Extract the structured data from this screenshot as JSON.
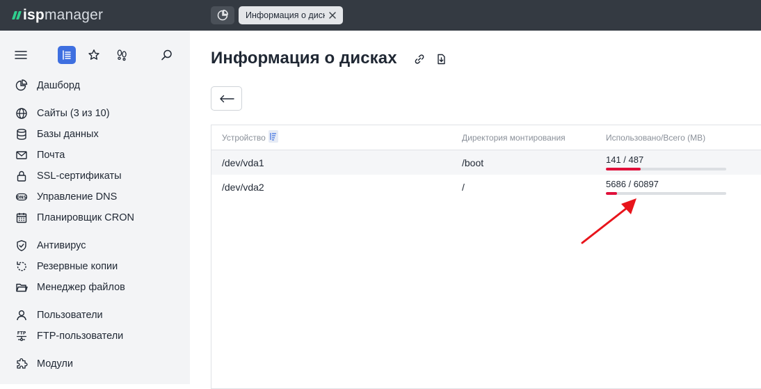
{
  "app": {
    "logo_isp": "isp",
    "logo_manager": "manager"
  },
  "tabs": {
    "active_label": "Информация о дисках"
  },
  "sidebar": {
    "items": [
      {
        "label": "Дашборд",
        "icon": "pie-chart-icon"
      },
      {
        "label": "Сайты (3 из 10)",
        "icon": "globe-icon"
      },
      {
        "label": "Базы данных",
        "icon": "database-icon"
      },
      {
        "label": "Почта",
        "icon": "mail-icon"
      },
      {
        "label": "SSL-сертификаты",
        "icon": "lock-icon"
      },
      {
        "label": "Управление DNS",
        "icon": "dns-icon"
      },
      {
        "label": "Планировщик CRON",
        "icon": "calendar-icon"
      },
      {
        "label": "Антивирус",
        "icon": "shield-icon"
      },
      {
        "label": "Резервные копии",
        "icon": "backup-icon"
      },
      {
        "label": "Менеджер файлов",
        "icon": "folder-icon"
      },
      {
        "label": "Пользователи",
        "icon": "user-icon"
      },
      {
        "label": "FTP-пользователи",
        "icon": "ftp-icon"
      },
      {
        "label": "Модули",
        "icon": "puzzle-icon"
      }
    ]
  },
  "page": {
    "title": "Информация о дисках",
    "back_symbol": "⟵"
  },
  "table": {
    "columns": [
      "Устройство",
      "Директория монтирования",
      "Использовано/Всего (МВ)"
    ],
    "rows": [
      {
        "device": "/dev/vda1",
        "mount": "/boot",
        "usage": "141 / 487",
        "used": 141,
        "total": 487
      },
      {
        "device": "/dev/vda2",
        "mount": "/",
        "usage": "5686 / 60897",
        "used": 5686,
        "total": 60897
      }
    ]
  },
  "colors": {
    "accent": "#3e6fe0",
    "usage_bar": "#e0103a",
    "logo_green": "#2fcf8e",
    "annotation_arrow": "#e8141b"
  }
}
